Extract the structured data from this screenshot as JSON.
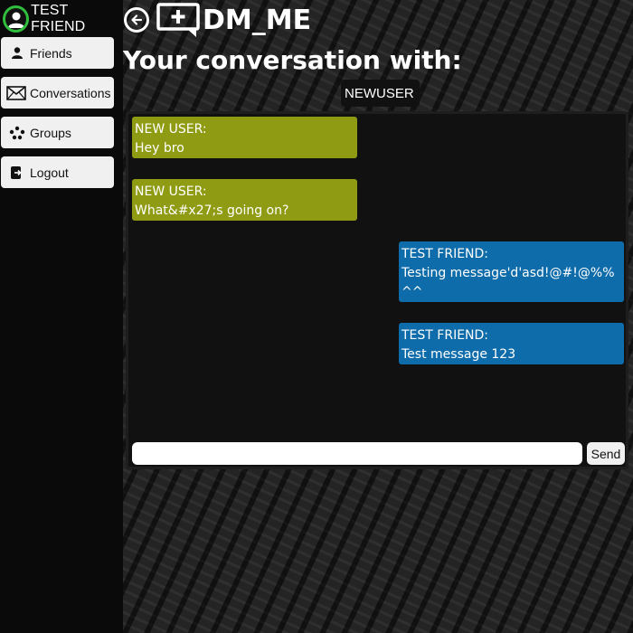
{
  "user": {
    "name": "TEST FRIEND",
    "avatar_icon": "user-avatar-icon",
    "avatar_ring_color": "#2fbf3c"
  },
  "sidebar": {
    "items": [
      {
        "label": "Friends",
        "icon": "person-icon"
      },
      {
        "label": "Conversations",
        "icon": "envelope-icon"
      },
      {
        "label": "Groups",
        "icon": "group-icon"
      },
      {
        "label": "Logout",
        "icon": "logout-icon"
      }
    ]
  },
  "header": {
    "back_icon": "back-arrow-icon",
    "logo_text": "DM_ME",
    "logo_icon": "chat-plus-icon"
  },
  "page": {
    "title": "Your conversation with:",
    "recipient": "NEWUSER"
  },
  "messages": [
    {
      "author": "NEW USER:",
      "text": "Hey bro",
      "side": "theirs"
    },
    {
      "author": "NEW USER:",
      "text": "What&#x27;s going on?",
      "side": "theirs"
    },
    {
      "author": "TEST FRIEND:",
      "text": "Testing message'd'asd!@#!@%%^^",
      "side": "mine"
    },
    {
      "author": "TEST FRIEND:",
      "text": "Test message 123",
      "side": "mine"
    }
  ],
  "composer": {
    "value": "",
    "placeholder": "",
    "send_label": "Send"
  },
  "colors": {
    "their_bubble": "#8f9b12",
    "my_bubble": "#0e6cab",
    "sidebar_bg": "#0a0a0a",
    "panel_bg": "#111111"
  }
}
